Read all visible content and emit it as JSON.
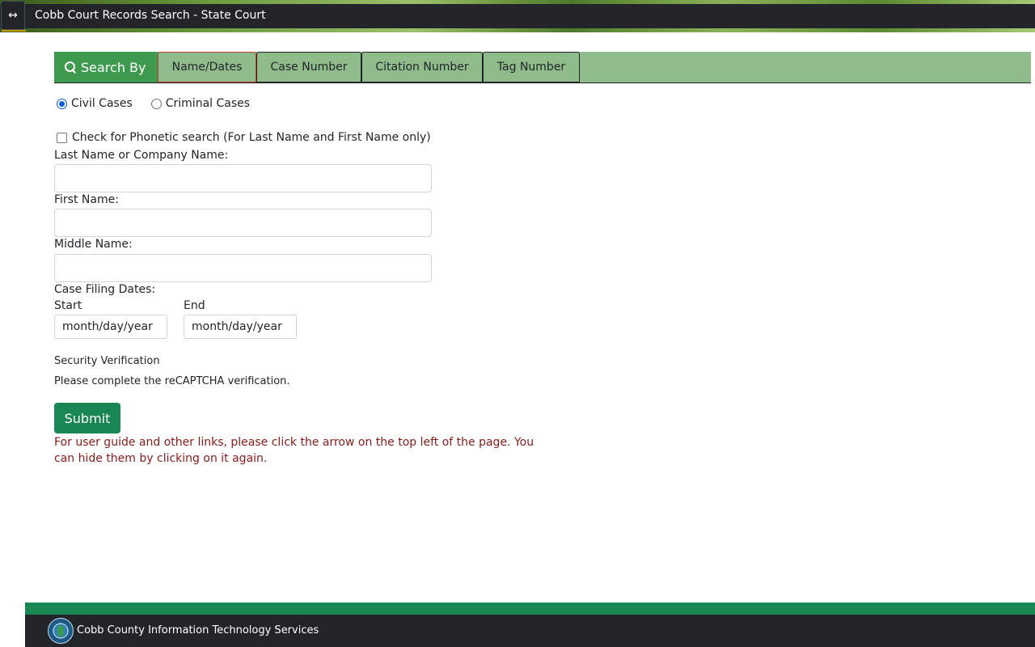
{
  "header": {
    "toggle_glyph": "↔",
    "title": "Cobb Court Records Search - State Court"
  },
  "tabs": {
    "search_by_label": "Search By",
    "items": [
      {
        "label": "Name/Dates",
        "active": true
      },
      {
        "label": "Case Number",
        "active": false
      },
      {
        "label": "Citation Number",
        "active": false
      },
      {
        "label": "Tag Number",
        "active": false
      }
    ]
  },
  "case_type": {
    "options": [
      {
        "label": "Civil Cases",
        "checked": true
      },
      {
        "label": "Criminal Cases",
        "checked": false
      }
    ]
  },
  "phonetic": {
    "label": "Check for Phonetic search (For Last Name and First Name only)",
    "checked": false
  },
  "form": {
    "last_name_label": "Last Name or Company Name:",
    "last_name_value": "",
    "first_name_label": "First Name:",
    "first_name_value": "",
    "middle_name_label": "Middle Name:",
    "middle_name_value": "",
    "filing_dates_label": "Case Filing Dates:",
    "start_label": "Start",
    "start_placeholder": "month/day/year",
    "end_label": "End",
    "end_placeholder": "month/day/year"
  },
  "security": {
    "title": "Security Verification",
    "message": "Please complete the reCAPTCHA verification."
  },
  "submit_label": "Submit",
  "note": "For user guide and other links, please click the arrow on the top left of the page. You can hide them by clicking on it again.",
  "footer": {
    "text": "Cobb County Information Technology Services"
  },
  "colors": {
    "tab_bar": "#8fbc8a",
    "search_by": "#3d9a4e",
    "submit": "#198754",
    "note": "#8b1a1a",
    "header_bar": "#212529"
  }
}
